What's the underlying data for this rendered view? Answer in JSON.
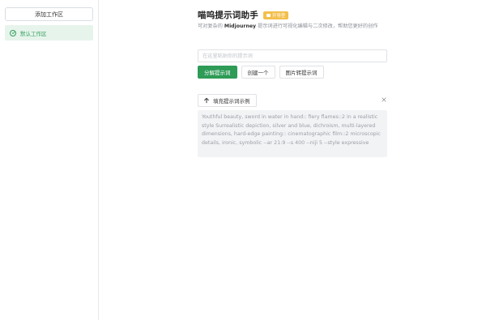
{
  "sidebar": {
    "add_workspace_label": "添加工作区",
    "workspaces": [
      {
        "label": "默认工作区",
        "active": true
      }
    ]
  },
  "header": {
    "title": "喵呜提示词助手",
    "badge_label": "开导型"
  },
  "description": {
    "prefix": "可对复杂的 ",
    "highlight": "Midjourney",
    "suffix": " 提示词进行可视化编辑与二次修改，帮助您更好的创作"
  },
  "prompt_input": {
    "placeholder": "在这里粘贴你的提示词",
    "value": ""
  },
  "actions": {
    "parse_label": "分解提示词",
    "create_label": "创建一个",
    "image_to_prompt_label": "图片转提示词"
  },
  "example": {
    "fill_label": "填充提示词示例",
    "text": "Youthful beauty, sword in water in hand:: fiery flames::2 in a realistic style Surrealistic depiction, silver and blue, dichroism, multi-layered dimensions, hard-edge painting:: cinematographic film::2 microscopic details, ironic, symbolic --ar 21:9 --s 400 --niji 5 --style expressive"
  },
  "colors": {
    "accent": "#2e9b57",
    "active_bg": "#e7f4ec",
    "badge": "#f3bf4c"
  },
  "icons": {
    "workspace": "check-circle-icon",
    "fill": "arrow-up-icon",
    "close": "close-icon",
    "badge": "ticket-icon"
  }
}
